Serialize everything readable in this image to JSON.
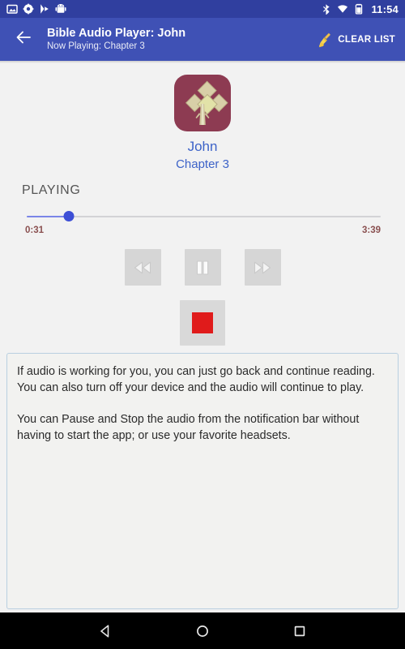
{
  "status_bar": {
    "time": "11:54",
    "left_icons": [
      {
        "name": "screenshot-icon"
      },
      {
        "name": "plus-circle-icon"
      },
      {
        "name": "play-store-icon"
      },
      {
        "name": "android-robot-icon"
      }
    ],
    "right_icons": [
      {
        "name": "bluetooth-icon"
      },
      {
        "name": "wifi-icon"
      },
      {
        "name": "battery-icon"
      }
    ]
  },
  "app_bar": {
    "back_icon": "back-arrow-icon",
    "title": "Bible Audio Player: John",
    "subtitle": "Now Playing: Chapter 3",
    "action_icon": "broom-icon",
    "action_label": "CLEAR LIST"
  },
  "player": {
    "album_art_icon": "bible-cross-art-icon",
    "track_title": "John",
    "track_subtitle": "Chapter 3",
    "state_label": "PLAYING",
    "elapsed_time": "0:31",
    "total_time": "3:39",
    "progress_percent": 12,
    "controls": [
      {
        "name": "rewind-button",
        "icon": "rewind-icon"
      },
      {
        "name": "pause-button",
        "icon": "pause-icon"
      },
      {
        "name": "fast-forward-button",
        "icon": "fast-forward-icon"
      }
    ],
    "stop_button": {
      "icon": "stop-square-icon",
      "label": "Stop"
    }
  },
  "info_box": {
    "paragraph_1": "If audio is working for you, you can just go back and continue reading. You can also turn off your device and the audio will continue to play.",
    "paragraph_2": "You can Pause and Stop the audio from the notification bar without having to start the app; or use your favorite headsets."
  },
  "nav_bar": {
    "back_label": "back-triangle-icon",
    "home_label": "home-circle-icon",
    "recents_label": "recents-square-icon"
  },
  "colors": {
    "status_bar": "#303f9f",
    "app_bar": "#3f51b5",
    "page_background": "#f2f2f2",
    "link_blue": "#3d63c8",
    "seek_fill": "#7b86e8",
    "seek_thumb": "#3d4fd6",
    "time_text": "#8a5050",
    "stop_red": "#e01b1b",
    "album_art": "#8d3b52",
    "info_border": "#b9cfe0"
  }
}
